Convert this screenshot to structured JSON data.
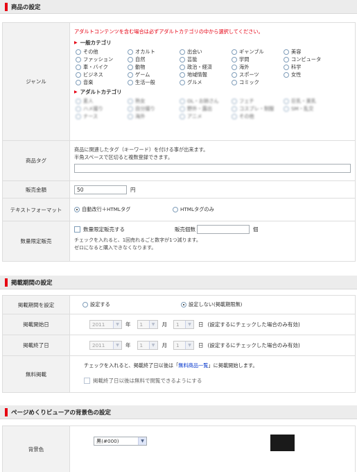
{
  "product_section": {
    "title": "商品の設定",
    "genre": {
      "label": "ジャンル",
      "warning": "アダルトコンテンツを含む場合は必ずアダルトカテゴリの中から選択してください。",
      "general_heading": "一般カテゴリ",
      "general_items": [
        "その他",
        "オカルト",
        "出会い",
        "ギャンブル",
        "美容",
        "ファッション",
        "自然",
        "芸能",
        "学問",
        "コンピュータ",
        "車・バイク",
        "動物",
        "政治・経済",
        "海外",
        "科学",
        "ビジネス",
        "ゲーム",
        "地域情報",
        "スポーツ",
        "女性",
        "音楽",
        "生活一般",
        "グルメ",
        "コミック"
      ],
      "adult_heading": "アダルトカテゴリ",
      "adult_items": [
        "素人",
        "熟女",
        "OL・お姉さん",
        "フェチ",
        "巨乳・美乳",
        "ハメ撮り",
        "自分撮り",
        "野外・露出",
        "コスプレ・制服",
        "SM・乱交",
        "ナース",
        "海外",
        "アニメ",
        "その他"
      ]
    },
    "tag": {
      "label": "商品タグ",
      "help_line1": "商品に関連したタグ（キーワード）を付ける事が出来ます。",
      "help_line2": "半角スペースで区切ると複数登録できます。",
      "value": ""
    },
    "price": {
      "label": "販売金額",
      "value": "50",
      "unit": "円"
    },
    "text_format": {
      "label": "テキストフォーマット",
      "option_auto": "自動改行＋HTMLタグ",
      "option_html": "HTMLタグのみ"
    },
    "limited": {
      "label": "数量限定販売",
      "checkbox_label": "数量限定販売する",
      "count_label": "販売個数",
      "count_value": "",
      "count_unit": "個",
      "note1": "チェックを入れると、1回売れるごと数字が1つ減ります。",
      "note2": "ゼロになると購入できなくなります。"
    }
  },
  "period_section": {
    "title": "掲載期間の設定",
    "setting": {
      "label": "掲載期間を設定",
      "option_set": "設定する",
      "option_unset": "設定しない(掲載期限無)"
    },
    "start": {
      "label": "掲載開始日",
      "year": "2011",
      "year_unit": "年",
      "month": "1",
      "month_unit": "月",
      "day": "1",
      "day_unit": "日",
      "note": "(設定するにチェックした場合のみ有効)"
    },
    "end": {
      "label": "掲載終了日",
      "year": "2011",
      "year_unit": "年",
      "month": "1",
      "month_unit": "月",
      "day": "1",
      "day_unit": "日",
      "note": "(設定するにチェックした場合のみ有効)"
    },
    "free": {
      "label": "無料掲載",
      "text_before": "チェックを入れると、掲載終了日以後は「",
      "link_text": "無料商品一覧",
      "text_after": "」に掲載開始します。",
      "checkbox_label": "掲載終了日以後は無料で閲覧できるようにする"
    }
  },
  "viewer_section": {
    "title": "ページめくりビューアの背景色の設定",
    "bg": {
      "label": "背景色",
      "value": "黒(#000)",
      "swatch_color": "#1a1a1a"
    }
  }
}
